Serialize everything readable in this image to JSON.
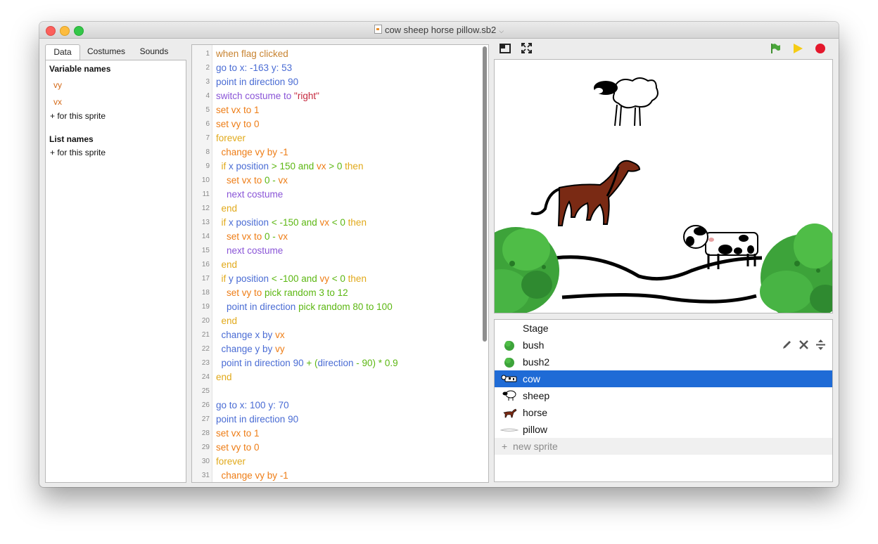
{
  "window": {
    "title": "cow sheep horse pillow.sb2",
    "title_dropdown_icon": "chevron-down-icon"
  },
  "left_tabs": [
    "Data",
    "Costumes",
    "Sounds"
  ],
  "data_panel": {
    "variable_header": "Variable names",
    "variables": [
      "vy",
      "vx"
    ],
    "add_variable": "+ for this sprite",
    "list_header": "List names",
    "add_list": "+ for this sprite"
  },
  "code": {
    "line_numbers": [
      "1",
      "2",
      "3",
      "4",
      "5",
      "6",
      "7",
      "8",
      "9",
      "10",
      "11",
      "12",
      "13",
      "14",
      "15",
      "16",
      "17",
      "18",
      "19",
      "20",
      "21",
      "22",
      "23",
      "24",
      "25",
      "26",
      "27",
      "28",
      "29",
      "30",
      "31"
    ],
    "lines": [
      [
        {
          "t": "when flag clicked",
          "c": "event"
        }
      ],
      [
        {
          "t": "go to x: ",
          "c": "motion"
        },
        {
          "t": "-163",
          "c": "motion"
        },
        {
          "t": " y: ",
          "c": "motion"
        },
        {
          "t": "53",
          "c": "motion"
        }
      ],
      [
        {
          "t": "point in direction ",
          "c": "motion"
        },
        {
          "t": "90",
          "c": "motion"
        }
      ],
      [
        {
          "t": "switch costume to ",
          "c": "looks"
        },
        {
          "t": "\"right\"",
          "c": "str"
        }
      ],
      [
        {
          "t": "set vx to ",
          "c": "data"
        },
        {
          "t": "1",
          "c": "data"
        }
      ],
      [
        {
          "t": "set vy to ",
          "c": "data"
        },
        {
          "t": "0",
          "c": "data"
        }
      ],
      [
        {
          "t": "forever",
          "c": "control"
        }
      ],
      [
        {
          "t": "  change vy by ",
          "c": "data"
        },
        {
          "t": "-1",
          "c": "data"
        }
      ],
      [
        {
          "t": "  if ",
          "c": "control"
        },
        {
          "t": "x position",
          "c": "motion"
        },
        {
          "t": " > ",
          "c": "op"
        },
        {
          "t": "150",
          "c": "op"
        },
        {
          "t": " and ",
          "c": "op"
        },
        {
          "t": "vx",
          "c": "data"
        },
        {
          "t": " > ",
          "c": "op"
        },
        {
          "t": "0",
          "c": "op"
        },
        {
          "t": " then",
          "c": "control"
        }
      ],
      [
        {
          "t": "    set vx to ",
          "c": "data"
        },
        {
          "t": "0",
          "c": "op"
        },
        {
          "t": " - ",
          "c": "op"
        },
        {
          "t": "vx",
          "c": "data"
        }
      ],
      [
        {
          "t": "    next costume",
          "c": "looks"
        }
      ],
      [
        {
          "t": "  end",
          "c": "control"
        }
      ],
      [
        {
          "t": "  if ",
          "c": "control"
        },
        {
          "t": "x position",
          "c": "motion"
        },
        {
          "t": " < ",
          "c": "op"
        },
        {
          "t": "-150",
          "c": "op"
        },
        {
          "t": " and ",
          "c": "op"
        },
        {
          "t": "vx",
          "c": "data"
        },
        {
          "t": " < ",
          "c": "op"
        },
        {
          "t": "0",
          "c": "op"
        },
        {
          "t": " then",
          "c": "control"
        }
      ],
      [
        {
          "t": "    set vx to ",
          "c": "data"
        },
        {
          "t": "0",
          "c": "op"
        },
        {
          "t": " - ",
          "c": "op"
        },
        {
          "t": "vx",
          "c": "data"
        }
      ],
      [
        {
          "t": "    next costume",
          "c": "looks"
        }
      ],
      [
        {
          "t": "  end",
          "c": "control"
        }
      ],
      [
        {
          "t": "  if ",
          "c": "control"
        },
        {
          "t": "y position",
          "c": "motion"
        },
        {
          "t": " < ",
          "c": "op"
        },
        {
          "t": "-100",
          "c": "op"
        },
        {
          "t": " and ",
          "c": "op"
        },
        {
          "t": "vy",
          "c": "data"
        },
        {
          "t": " < ",
          "c": "op"
        },
        {
          "t": "0",
          "c": "op"
        },
        {
          "t": " then",
          "c": "control"
        }
      ],
      [
        {
          "t": "    set vy to ",
          "c": "data"
        },
        {
          "t": "pick random ",
          "c": "op"
        },
        {
          "t": "3",
          "c": "op"
        },
        {
          "t": " to ",
          "c": "op"
        },
        {
          "t": "12",
          "c": "op"
        }
      ],
      [
        {
          "t": "    point in direction ",
          "c": "motion"
        },
        {
          "t": "pick random ",
          "c": "op"
        },
        {
          "t": "80",
          "c": "op"
        },
        {
          "t": " to ",
          "c": "op"
        },
        {
          "t": "100",
          "c": "op"
        }
      ],
      [
        {
          "t": "  end",
          "c": "control"
        }
      ],
      [
        {
          "t": "  change x by ",
          "c": "motion"
        },
        {
          "t": "vx",
          "c": "data"
        }
      ],
      [
        {
          "t": "  change y by ",
          "c": "motion"
        },
        {
          "t": "vy",
          "c": "data"
        }
      ],
      [
        {
          "t": "  point in direction ",
          "c": "motion"
        },
        {
          "t": "90",
          "c": "motion"
        },
        {
          "t": " + ",
          "c": "op"
        },
        {
          "t": "(",
          "c": "op"
        },
        {
          "t": "direction",
          "c": "motion"
        },
        {
          "t": " - ",
          "c": "op"
        },
        {
          "t": "90",
          "c": "op"
        },
        {
          "t": ")",
          "c": "op"
        },
        {
          "t": " * ",
          "c": "op"
        },
        {
          "t": "0.9",
          "c": "op"
        }
      ],
      [
        {
          "t": "end",
          "c": "control"
        }
      ],
      [],
      [
        {
          "t": "go to x: ",
          "c": "motion"
        },
        {
          "t": "100",
          "c": "motion"
        },
        {
          "t": " y: ",
          "c": "motion"
        },
        {
          "t": "70",
          "c": "motion"
        }
      ],
      [
        {
          "t": "point in direction ",
          "c": "motion"
        },
        {
          "t": "90",
          "c": "motion"
        }
      ],
      [
        {
          "t": "set vx to ",
          "c": "data"
        },
        {
          "t": "1",
          "c": "data"
        }
      ],
      [
        {
          "t": "set vy to ",
          "c": "data"
        },
        {
          "t": "0",
          "c": "data"
        }
      ],
      [
        {
          "t": "forever",
          "c": "control"
        }
      ],
      [
        {
          "t": "  change vy by ",
          "c": "data"
        },
        {
          "t": "-1",
          "c": "data"
        }
      ]
    ]
  },
  "colors": {
    "event": "#c88330",
    "motion": "#4a6cd4",
    "looks": "#8a55d7",
    "data": "#ee7d16",
    "control": "#e1a91a",
    "op": "#5cb712",
    "str": "#c5283d",
    "selection": "#1f6bd6",
    "flag": "#4aa63a",
    "run": "#f5cc15",
    "stop": "#e4182c"
  },
  "toolbar_icons": [
    "small-stage-icon",
    "fullscreen-icon",
    "green-flag-icon",
    "turbo-icon",
    "stop-icon"
  ],
  "sprites": [
    {
      "name": "Stage",
      "thumb": "none"
    },
    {
      "name": "bush",
      "thumb": "bush"
    },
    {
      "name": "bush2",
      "thumb": "bush"
    },
    {
      "name": "cow",
      "thumb": "cow"
    },
    {
      "name": "sheep",
      "thumb": "sheep"
    },
    {
      "name": "horse",
      "thumb": "horse"
    },
    {
      "name": "pillow",
      "thumb": "pillow"
    }
  ],
  "selected_sprite": "cow",
  "sprite_actions": [
    "edit-icon",
    "delete-icon",
    "move-icon"
  ],
  "new_sprite": {
    "plus": "+",
    "label": "new sprite"
  }
}
